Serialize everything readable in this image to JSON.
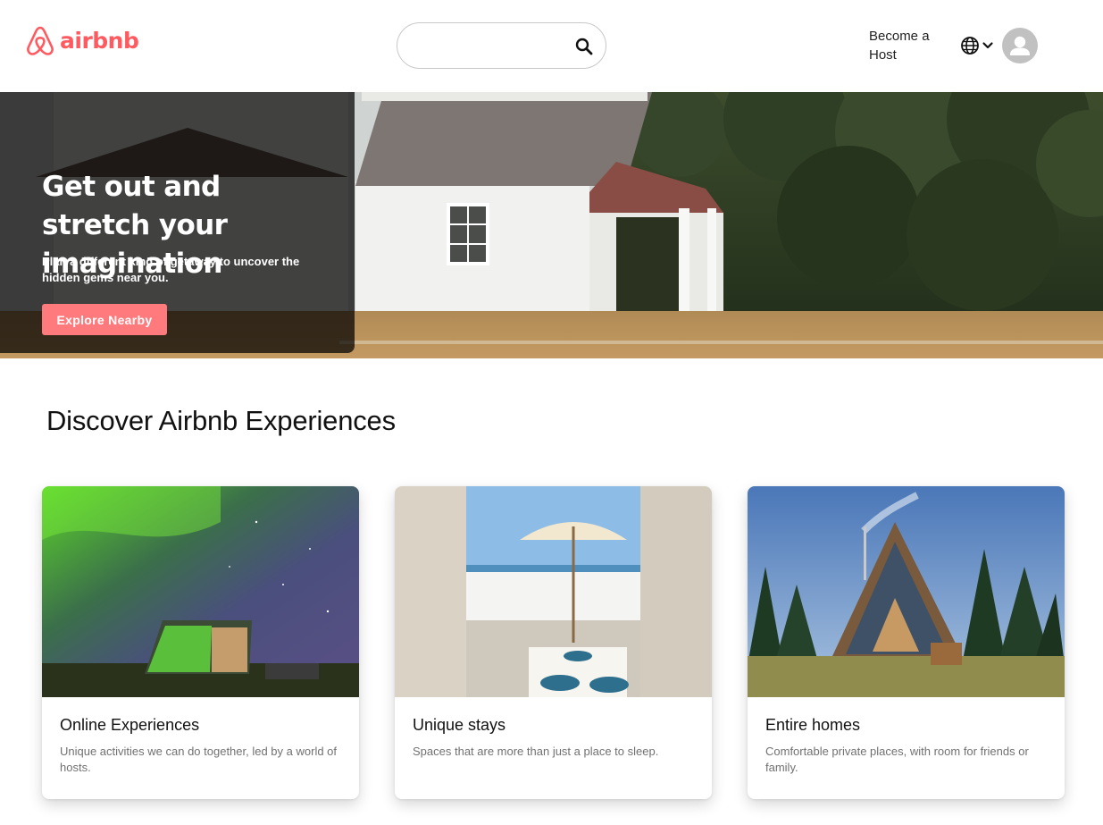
{
  "brand": {
    "name": "airbnb",
    "color": "#ff5a5f"
  },
  "header": {
    "search": {
      "placeholder": "",
      "value": "",
      "icon": "search-icon"
    },
    "host_link": "Become a Host",
    "language_icon": "globe-icon",
    "avatar_icon": "user-avatar-icon"
  },
  "hero": {
    "title": "Get out and stretch your imagination",
    "subtitle": "Plan a different kind of getaway to uncover the hidden gems near you.",
    "button": "Explore Nearby",
    "accent": "#ff7a7d"
  },
  "section": {
    "title": "Discover Airbnb Experiences",
    "cards": [
      {
        "title": "Online Experiences",
        "description": "Unique activities we can do together, led by a world of hosts.",
        "image": "northern-lights-glass-cabin"
      },
      {
        "title": "Unique stays",
        "description": "Spaces that are more than just a place to sleep.",
        "image": "seaside-terrace-with-umbrella"
      },
      {
        "title": "Entire homes",
        "description": "Comfortable private places, with room for friends or family.",
        "image": "a-frame-cabin-in-forest"
      }
    ]
  }
}
